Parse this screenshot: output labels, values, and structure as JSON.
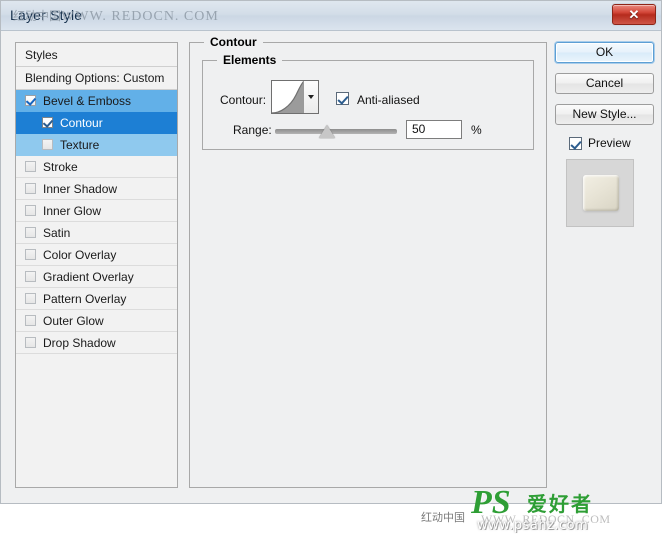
{
  "window": {
    "title": "Layer Style",
    "close_label": "✕"
  },
  "watermarks": {
    "top": "WWW. REDOCN. COM",
    "top_cn": "红动中国",
    "bottom_cn": "红动中国",
    "bottom_url": "WWW. REDOCN. COM",
    "logo_ps": "PS",
    "logo_cn": "爱好者",
    "logo_url": "www.psahz.com"
  },
  "sidebar": {
    "header": "Styles",
    "blending_options": "Blending Options: Custom",
    "items": [
      {
        "label": "Bevel & Emboss",
        "checked": true,
        "state": "parent-selected",
        "indent": false
      },
      {
        "label": "Contour",
        "checked": true,
        "state": "selected",
        "indent": true
      },
      {
        "label": "Texture",
        "checked": false,
        "state": "sub",
        "indent": true
      },
      {
        "label": "Stroke",
        "checked": false,
        "state": "normal",
        "indent": false
      },
      {
        "label": "Inner Shadow",
        "checked": false,
        "state": "normal",
        "indent": false
      },
      {
        "label": "Inner Glow",
        "checked": false,
        "state": "normal",
        "indent": false
      },
      {
        "label": "Satin",
        "checked": false,
        "state": "normal",
        "indent": false
      },
      {
        "label": "Color Overlay",
        "checked": false,
        "state": "normal",
        "indent": false
      },
      {
        "label": "Gradient Overlay",
        "checked": false,
        "state": "normal",
        "indent": false
      },
      {
        "label": "Pattern Overlay",
        "checked": false,
        "state": "normal",
        "indent": false
      },
      {
        "label": "Outer Glow",
        "checked": false,
        "state": "normal",
        "indent": false
      },
      {
        "label": "Drop Shadow",
        "checked": false,
        "state": "normal",
        "indent": false
      }
    ]
  },
  "main": {
    "group_title": "Contour",
    "elements_title": "Elements",
    "contour_label": "Contour:",
    "anti_aliased_label": "Anti-aliased",
    "anti_aliased_checked": true,
    "range_label": "Range:",
    "range_value": "50",
    "range_percent_symbol": "%",
    "range_slider_position_pct": 50
  },
  "buttons": {
    "ok": "OK",
    "cancel": "Cancel",
    "new_style": "New Style...",
    "preview_label": "Preview",
    "preview_checked": true
  },
  "colors": {
    "titlebar": "#d3dde8",
    "dialog_bg": "#eff0f1",
    "highlight_selected": "#1d7fd4",
    "highlight_parent": "#62b0e8",
    "highlight_sub": "#8fc9ee",
    "close_button": "#b52b1d",
    "accent_focus": "#5d9fd4",
    "logo_green": "#2e9e35"
  }
}
